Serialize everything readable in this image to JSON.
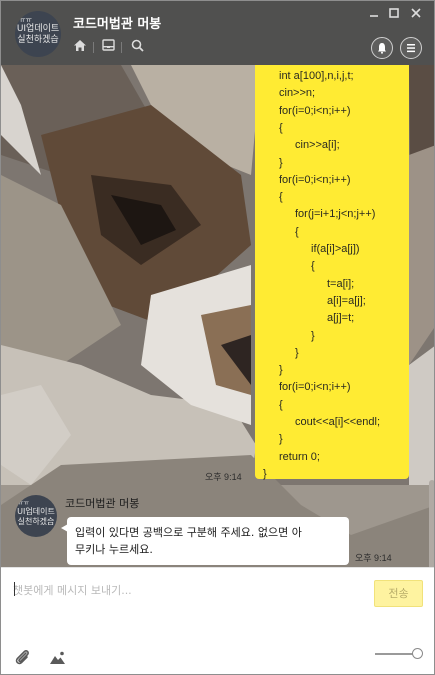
{
  "header": {
    "title": "코드머법관 머봉",
    "avatar_line1": "ㅠㅠ",
    "avatar_line2": "UI업데이트",
    "avatar_line3": "실천하겠습"
  },
  "code_message": {
    "lines": [
      "int a[100],n,i,j,t;",
      "cin>>n;",
      "for(i=0;i<n;i++)",
      "{",
      "cin>>a[i];",
      "}",
      "for(i=0;i<n;i++)",
      "{",
      "for(j=i+1;j<n;j++)",
      "{",
      "if(a[i]>a[j])",
      "{",
      "t=a[i];",
      "a[i]=a[j];",
      "a[j]=t;",
      "}",
      "}",
      "}",
      "for(i=0;i<n;i++)",
      "{",
      "cout<<a[i]<<endl;",
      "}",
      "return 0;",
      "}"
    ],
    "time": "오후 9:14"
  },
  "bot_message": {
    "sender": "코드머법관 머봉",
    "avatar_line1": "ㅠㅠ",
    "avatar_line2": "UI업데이트",
    "avatar_line3": "실천하겠습",
    "text_line1": "입력이 있다면 공백으로 구분해 주세요. 없으면 아",
    "text_line2": "무키나 누르세요.",
    "time": "오후 9:14"
  },
  "composer": {
    "placeholder": "챗봇에게 메시지 보내기...",
    "send_label": "전송"
  },
  "colors": {
    "header_bg": "#50504f",
    "my_bubble": "#ffeb33",
    "send_disabled": "#fef3a0"
  }
}
